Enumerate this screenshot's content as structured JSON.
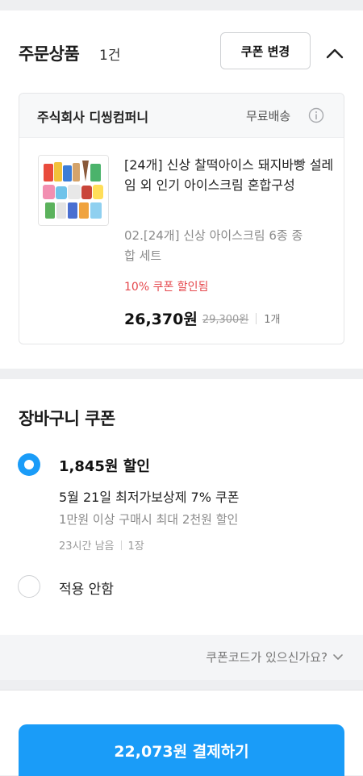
{
  "order": {
    "title": "주문상품",
    "count": "1건",
    "coupon_change_label": "쿠폰 변경",
    "collapse_icon": "chevron-up-icon",
    "seller": {
      "name": "주식회사 디씽컴퍼니",
      "shipping": "무료배송",
      "info_icon": "info-icon"
    },
    "product": {
      "name": "[24개] 신상 찰떡아이스 돼지바빵 설레임 외 인기 아이스크림 혼합구성",
      "option": "02.[24개] 신상 아이스크림 6종 종합 세트",
      "coupon_applied": "10% 쿠폰 할인됨",
      "sale_price": "26,370원",
      "original_price": "29,300원",
      "quantity": "1개"
    }
  },
  "cart_coupon": {
    "title": "장바구니 쿠폰",
    "options": [
      {
        "selected": true,
        "discount": "1,845원 할인",
        "name": "5월 21일 최저가보상제 7% 쿠폰",
        "condition": "1만원 이상 구매시 최대 2천원 할인",
        "time_left": "23시간 남음",
        "count": "1장"
      },
      {
        "selected": false,
        "label": "적용 안함"
      }
    ],
    "accent_color": "#1a9cf8"
  },
  "coupon_code": {
    "link_label": "쿠폰코드가 있으신가요?",
    "icon": "chevron-down-icon"
  },
  "payment": {
    "button_label": "22,073원 결제하기",
    "color": "#1a9cf8"
  }
}
